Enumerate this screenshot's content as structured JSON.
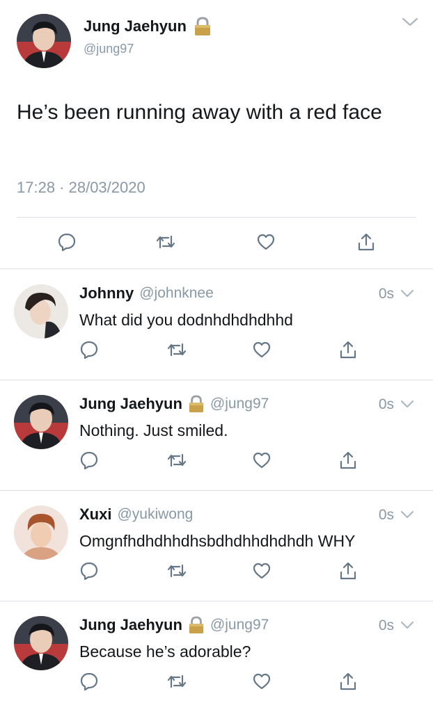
{
  "main_tweet": {
    "name": "Jung Jaehyun",
    "handle": "@jung97",
    "text": "He’s been running away with a red face",
    "timestamp": "17:28 · 28/03/2020",
    "locked": true,
    "avatar_color": "#2b2f3a"
  },
  "replies": [
    {
      "name": "Johnny",
      "handle": "@johnknee",
      "time": "0s",
      "text": "What did you dodnhdhdhdhhd",
      "locked": false,
      "avatar_color": "#3a302c"
    },
    {
      "name": "Jung Jaehyun",
      "handle": "@jung97",
      "time": "0s",
      "text": "Nothing. Just smiled.",
      "locked": true,
      "avatar_color": "#2b2f3a"
    },
    {
      "name": "Xuxi",
      "handle": "@yukiwong",
      "time": "0s",
      "text": "Omgnfhdhdhhdhsbdhdhhdhdhdh WHY",
      "locked": false,
      "avatar_color": "#c98e6b"
    },
    {
      "name": "Jung Jaehyun",
      "handle": "@jung97",
      "time": "0s",
      "text": "Because he’s adorable?",
      "locked": true,
      "avatar_color": "#2b2f3a"
    }
  ],
  "colors": {
    "text": "#14171a",
    "secondary": "#8899a6",
    "icon": "#657786",
    "divider": "#d9dfe3",
    "lock": "#c9a14a"
  },
  "icons": [
    "reply-icon",
    "retweet-icon",
    "like-icon",
    "share-icon",
    "chevron-down-icon",
    "lock-icon"
  ]
}
